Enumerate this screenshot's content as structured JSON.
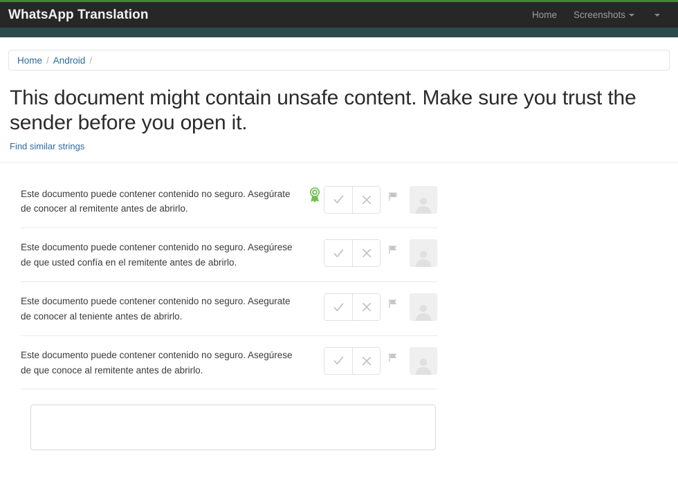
{
  "navbar": {
    "brand": "WhatsApp Translation",
    "links": [
      {
        "label": "Home",
        "icon": "",
        "has_caret": false
      },
      {
        "label": "Screenshots",
        "icon": "chevron-down-icon",
        "has_caret": true
      },
      {
        "label": "",
        "icon": "chevron-down-icon",
        "has_caret": true
      }
    ],
    "accent_color": "#3a8a3a",
    "background_color": "#272727",
    "strip_color": "#2b4a4a"
  },
  "breadcrumb": {
    "items": [
      "Home",
      "Android"
    ],
    "separator": "/",
    "trailing_separator": "/"
  },
  "page": {
    "title": "This document might contain unsafe content. Make sure you trust the sender before you open it.",
    "find_similar_label": "Find similar strings",
    "link_color": "#2c6aa0"
  },
  "suggestions": [
    {
      "text": "Este documento puede contener contenido no seguro. Asegúrate de conocer al remitente antes de abrirlo.",
      "approved": true,
      "badge_icon": "award-ribbon-icon",
      "badge_color": "#6fc04a",
      "accept_icon": "check-icon",
      "reject_icon": "x-icon",
      "flag_icon": "flag-icon",
      "avatar_icon": "user-avatar-icon"
    },
    {
      "text": "Este documento puede contener contenido no seguro. Asegúrese de que usted confía en el remitente antes de abrirlo.",
      "approved": false,
      "badge_icon": "",
      "badge_color": "",
      "accept_icon": "check-icon",
      "reject_icon": "x-icon",
      "flag_icon": "flag-icon",
      "avatar_icon": "user-avatar-icon"
    },
    {
      "text": "Este documento puede contener contenido no seguro. Asegurate de conocer al teniente antes de abrirlo.",
      "approved": false,
      "badge_icon": "",
      "badge_color": "",
      "accept_icon": "check-icon",
      "reject_icon": "x-icon",
      "flag_icon": "flag-icon",
      "avatar_icon": "user-avatar-icon"
    },
    {
      "text": "Este documento puede contener contenido no seguro. Asegúrese de que conoce al remitente antes de abrirlo.",
      "approved": false,
      "badge_icon": "",
      "badge_color": "",
      "accept_icon": "check-icon",
      "reject_icon": "x-icon",
      "flag_icon": "flag-icon",
      "avatar_icon": "user-avatar-icon"
    }
  ],
  "compose": {
    "value": "",
    "placeholder": ""
  }
}
